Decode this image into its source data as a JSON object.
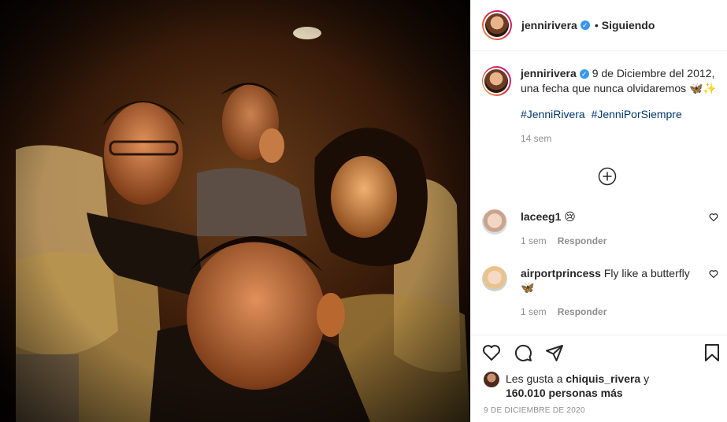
{
  "header": {
    "username": "jennirivera",
    "verified_glyph": "✓",
    "separator": "•",
    "follow_status": "Siguiendo"
  },
  "caption": {
    "username": "jennirivera",
    "text": "9 de Diciembre del 2012, una fecha que nunca olvidaremos 🦋✨",
    "hashtags": [
      "#JenniRivera",
      "#JenniPorSiempre"
    ],
    "time": "14 sem"
  },
  "load_more_icon": "plus-circle-icon",
  "comments": [
    {
      "username": "laceeg1",
      "text": "😢",
      "time": "1 sem",
      "reply": "Responder"
    },
    {
      "username": "airportprincess",
      "text": "Fly like a butterfly 🦋",
      "time": "1 sem",
      "reply": "Responder"
    }
  ],
  "actions": {
    "icons": [
      "heart-icon",
      "comment-icon",
      "share-icon",
      "bookmark-icon"
    ]
  },
  "likes": {
    "prefix": "Les gusta a",
    "user": "chiquis_rivera",
    "conj": "y",
    "count": "160.010 personas más"
  },
  "date": "9 DE DICIEMBRE DE 2020",
  "colors": {
    "verified": "#3897f0",
    "hashtag": "#00376b",
    "muted": "#8e8e8e"
  }
}
